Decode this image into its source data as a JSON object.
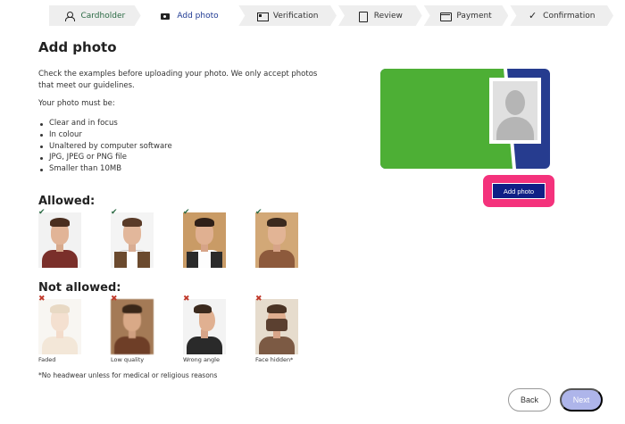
{
  "stepper": {
    "steps": [
      {
        "label": "Cardholder",
        "icon": "person-icon",
        "state": "done"
      },
      {
        "label": "Add photo",
        "icon": "camera-icon",
        "state": "active"
      },
      {
        "label": "Verification",
        "icon": "id-card-icon",
        "state": "upcoming"
      },
      {
        "label": "Review",
        "icon": "document-icon",
        "state": "upcoming"
      },
      {
        "label": "Payment",
        "icon": "credit-card-icon",
        "state": "upcoming"
      },
      {
        "label": "Confirmation",
        "icon": "checkmark-icon",
        "state": "upcoming"
      }
    ]
  },
  "main": {
    "title": "Add photo",
    "intro": "Check the examples before uploading your photo. We only accept photos that meet our guidelines.",
    "must_be": "Your photo must be:",
    "requirements": [
      "Clear and in focus",
      "In colour",
      "Unaltered by computer software",
      "JPG, JPEG or PNG file",
      "Smaller than 10MB"
    ],
    "allowed_heading": "Allowed:",
    "not_allowed_heading": "Not allowed:",
    "allowed_marks": [
      "✔",
      "✔",
      "✔",
      "✔"
    ],
    "not_allowed": [
      {
        "mark": "✖",
        "caption": "Faded"
      },
      {
        "mark": "✖",
        "caption": "Low quality"
      },
      {
        "mark": "✖",
        "caption": "Wrong angle"
      },
      {
        "mark": "✖",
        "caption": "Face hidden*"
      }
    ],
    "footnote": "*No headwear unless for medical or religious reasons"
  },
  "card": {
    "add_photo_label": "Add photo",
    "colors": {
      "green": "#4daf35",
      "navy": "#263c8f",
      "highlight": "#f4327c",
      "button": "#0f1f86"
    }
  },
  "nav": {
    "back_label": "Back",
    "next_label": "Next"
  }
}
